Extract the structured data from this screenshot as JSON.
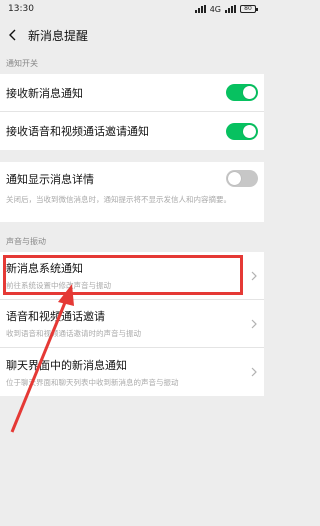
{
  "status_bar": {
    "time": "13:30",
    "network": "4G",
    "battery": "80"
  },
  "nav": {
    "title": "新消息提醒"
  },
  "section1": {
    "header": "通知开关",
    "rows": [
      {
        "label": "接收新消息通知",
        "toggle": "on"
      },
      {
        "label": "接收语音和视频通话邀请通知",
        "toggle": "on"
      }
    ]
  },
  "details": {
    "label": "通知显示消息详情",
    "toggle": "off",
    "description": "关闭后，当收到微信消息时，通知提示将不显示发信人和内容摘要。"
  },
  "section2": {
    "header": "声音与振动",
    "rows": [
      {
        "label": "新消息系统通知",
        "sub": "前往系统设置中修改声音与振动"
      },
      {
        "label": "语音和视频通话邀请",
        "sub": "收到语音和视频通话邀请时的声音与振动"
      },
      {
        "label": "聊天界面中的新消息通知",
        "sub": "位于聊天界面和聊天列表中收到新消息的声音与振动"
      }
    ]
  },
  "colors": {
    "toggle_on": "#07c160",
    "toggle_off": "#c7c7c7",
    "annotation": "#e53935"
  }
}
